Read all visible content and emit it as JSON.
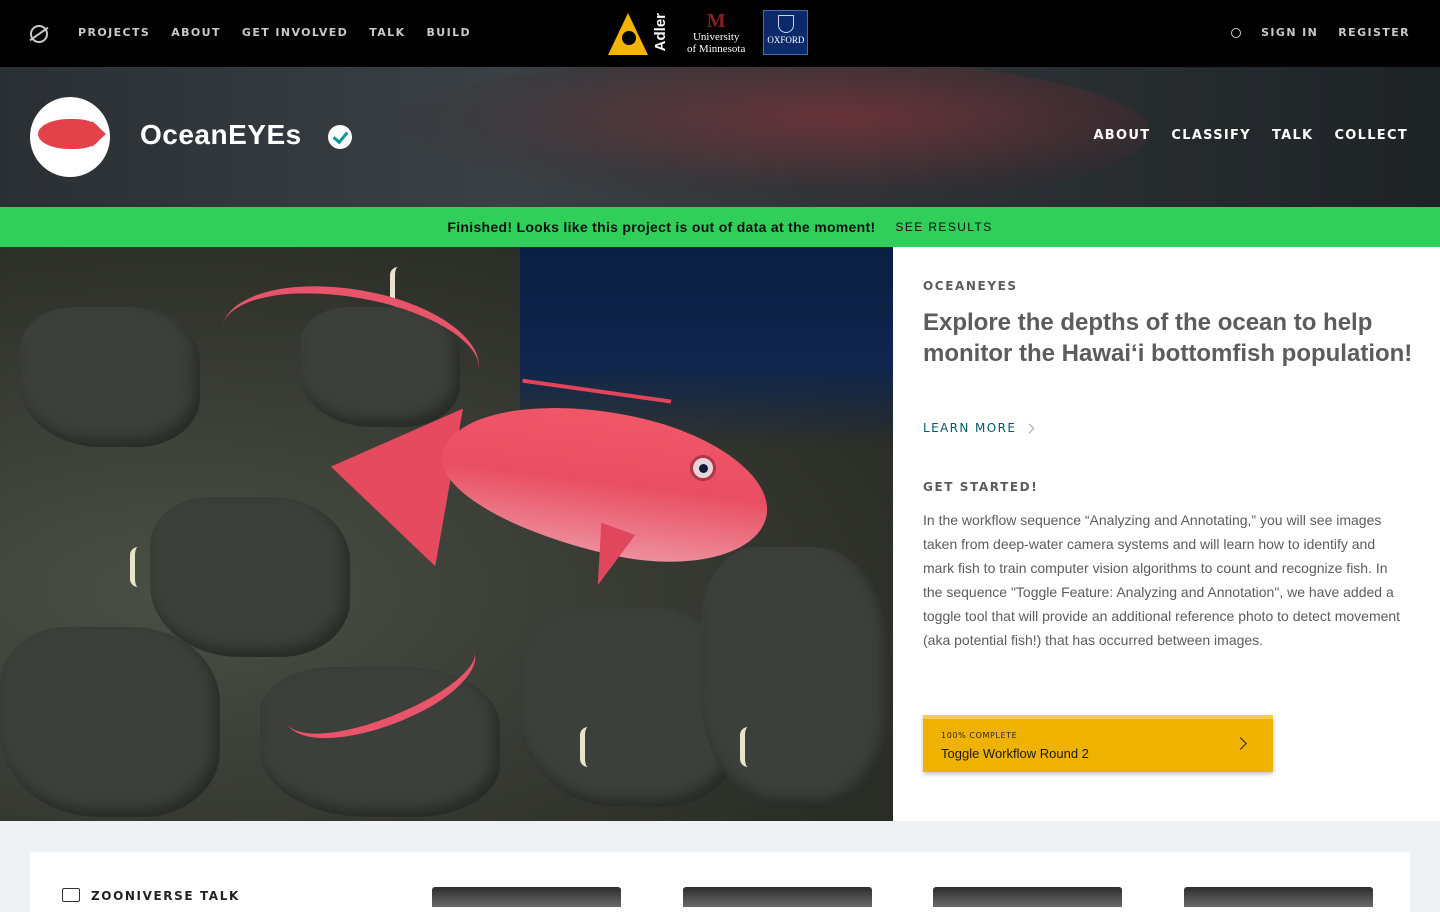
{
  "topbar": {
    "nav": [
      "PROJECTS",
      "ABOUT",
      "GET INVOLVED",
      "TALK",
      "BUILD"
    ],
    "partners": {
      "adler": "Adler",
      "umn_line1": "University",
      "umn_line2": "of Minnesota",
      "oxford": "OXFORD"
    },
    "sign_in": "SIGN IN",
    "register": "REGISTER"
  },
  "project": {
    "title": "OceanEYEs",
    "nav": [
      "ABOUT",
      "CLASSIFY",
      "TALK",
      "COLLECT"
    ]
  },
  "banner": {
    "message": "Finished! Looks like this project is out of data at the moment!",
    "link": "SEE RESULTS",
    "color": "#2fcf59"
  },
  "info": {
    "kicker": "OCEANEYES",
    "headline": "Explore the depths of the ocean to help monitor the Hawai‘i bottomfish population!",
    "learn_more": "LEARN MORE",
    "get_started": "GET STARTED!",
    "description": "In the workflow sequence “Analyzing and Annotating,” you will see images taken from deep-water camera systems and will learn how to identify and mark fish to train computer vision algorithms to count and recognize fish. In the sequence \"Toggle Feature: Analyzing and Annotation\", we have added a toggle tool that will provide an additional reference photo to detect movement (aka potential fish!) that has occurred between images.",
    "workflow": {
      "status": "100% COMPLETE",
      "name": "Toggle Workflow Round 2",
      "progress": 1.0,
      "color": "#f0b200"
    }
  },
  "talk": {
    "title": "ZOONIVERSE TALK"
  },
  "colors": {
    "accent": "#005d69",
    "verified": "#00979d"
  }
}
